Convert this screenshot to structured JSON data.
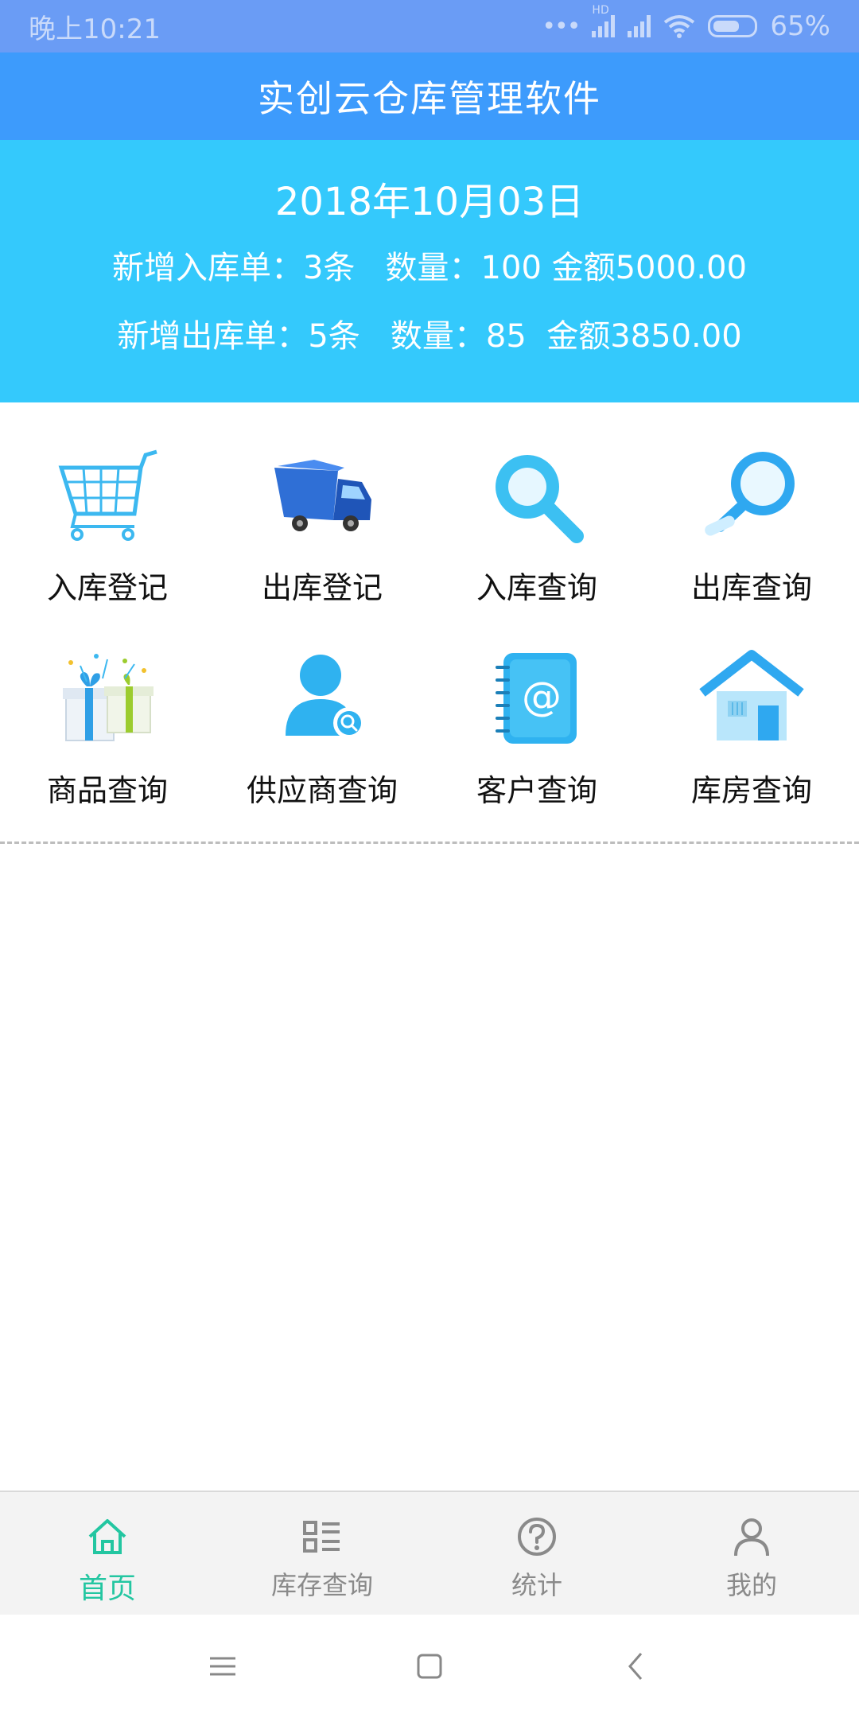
{
  "status_bar": {
    "time": "晚上10:21",
    "signal_label": "HD",
    "battery_percent": "65%",
    "battery_level": 0.65
  },
  "header": {
    "title": "实创云仓库管理软件"
  },
  "summary": {
    "date": "2018年10月03日",
    "inbound": "新增入库单：3条   数量：100 金额5000.00",
    "outbound": "新增出库单：5条   数量：85  金额3850.00"
  },
  "menu": [
    {
      "label": "入库登记",
      "icon": "cart-icon"
    },
    {
      "label": "出库登记",
      "icon": "truck-icon"
    },
    {
      "label": "入库查询",
      "icon": "magnifier-icon"
    },
    {
      "label": "出库查询",
      "icon": "magnifier-scroll-icon"
    },
    {
      "label": "商品查询",
      "icon": "gift-boxes-icon"
    },
    {
      "label": "供应商查询",
      "icon": "user-search-icon"
    },
    {
      "label": "客户查询",
      "icon": "address-book-icon"
    },
    {
      "label": "库房查询",
      "icon": "warehouse-icon"
    }
  ],
  "bottom_nav": [
    {
      "label": "首页",
      "icon": "home-icon",
      "active": true
    },
    {
      "label": "库存查询",
      "icon": "list-icon",
      "active": false
    },
    {
      "label": "统计",
      "icon": "question-icon",
      "active": false
    },
    {
      "label": "我的",
      "icon": "person-icon",
      "active": false
    }
  ],
  "colors": {
    "status_bar": "#6a9cf5",
    "header": "#3d9bfc",
    "summary": "#34c9fc",
    "active_tab": "#23c6a1",
    "icon_blue": "#3cb8f0"
  }
}
